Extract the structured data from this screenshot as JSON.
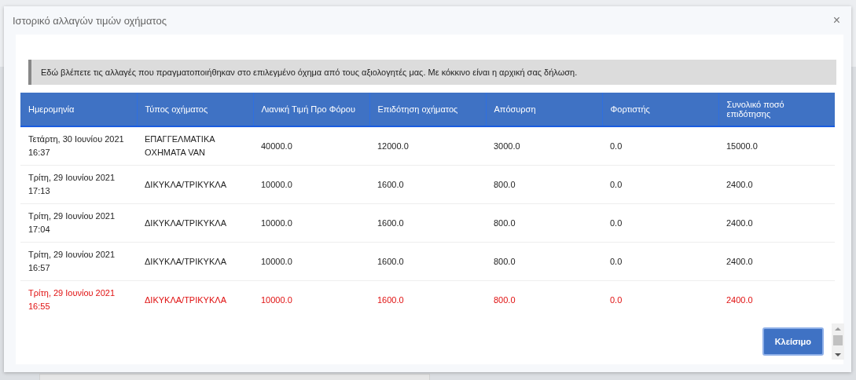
{
  "window": {
    "title": "Ιστορικό αλλαγών τιμών οχήματος",
    "close_icon": "×"
  },
  "notice": "Εδώ βλέπετε τις αλλαγές που πραγματοποιήθηκαν στο επιλεγμένο όχημα από τους αξιολογητές μας. Με κόκκινο είναι η αρχική σας δήλωση.",
  "table": {
    "columns": [
      "Ημερομηνία",
      "Τύπος οχήματος",
      "Λιανική Τιμή Προ Φόρου",
      "Επιδότηση οχήματος",
      "Απόσυρση",
      "Φορτιστής",
      "Συνολικό ποσό επιδότησης"
    ],
    "rows": [
      {
        "original": false,
        "cells": [
          "Τετάρτη, 30 Ιουνίου 2021 16:37",
          "ΕΠΑΓΓΕΛΜΑΤΙΚΑ ΟΧΗΜΑΤΑ VAN",
          "40000.0",
          "12000.0",
          "3000.0",
          "0.0",
          "15000.0"
        ]
      },
      {
        "original": false,
        "cells": [
          "Τρίτη, 29 Ιουνίου 2021 17:13",
          "ΔΙΚΥΚΛΑ/ΤΡΙΚΥΚΛΑ",
          "10000.0",
          "1600.0",
          "800.0",
          "0.0",
          "2400.0"
        ]
      },
      {
        "original": false,
        "cells": [
          "Τρίτη, 29 Ιουνίου 2021 17:04",
          "ΔΙΚΥΚΛΑ/ΤΡΙΚΥΚΛΑ",
          "10000.0",
          "1600.0",
          "800.0",
          "0.0",
          "2400.0"
        ]
      },
      {
        "original": false,
        "cells": [
          "Τρίτη, 29 Ιουνίου 2021 16:57",
          "ΔΙΚΥΚΛΑ/ΤΡΙΚΥΚΛΑ",
          "10000.0",
          "1600.0",
          "800.0",
          "0.0",
          "2400.0"
        ]
      },
      {
        "original": true,
        "cells": [
          "Τρίτη, 29 Ιουνίου 2021 16:55",
          "ΔΙΚΥΚΛΑ/ΤΡΙΚΥΚΛΑ",
          "10000.0",
          "1600.0",
          "800.0",
          "0.0",
          "2400.0"
        ]
      }
    ]
  },
  "buttons": [
    "Κλείσιμο"
  ]
}
